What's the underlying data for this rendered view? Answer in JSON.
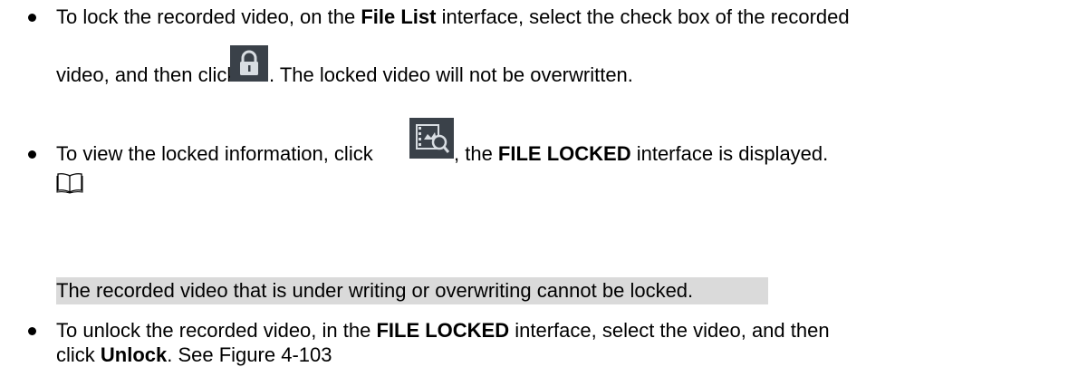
{
  "bullets": [
    {
      "line1": {
        "before": "To lock the recorded video, on the ",
        "bold": "File List",
        "after": " interface, select the check box of the recorded"
      },
      "line2": {
        "before": "video, and then click ",
        "icon": "lock-icon",
        "after": ". The locked video will not be overwritten."
      }
    },
    {
      "line1": {
        "before": "To view the locked information, click ",
        "icon": "file-locked-search-icon",
        "middle": ", the ",
        "bold": "FILE LOCKED",
        "after": " interface is displayed."
      }
    },
    {
      "line1": {
        "before": "To unlock the recorded video, in the ",
        "bold": "FILE LOCKED",
        "after": " interface, select the video, and then"
      },
      "line2": {
        "before": "click ",
        "bold": "Unlock",
        "after": ". See Figure 4-103"
      }
    }
  ],
  "note": {
    "icon": "book-note-icon",
    "text": "The recorded video that is under writing or overwriting cannot be locked."
  },
  "colors": {
    "text": "#000000",
    "note_highlight": "#dadada",
    "icon_background": "#3a4149",
    "icon_foreground": "#d8dde2"
  }
}
